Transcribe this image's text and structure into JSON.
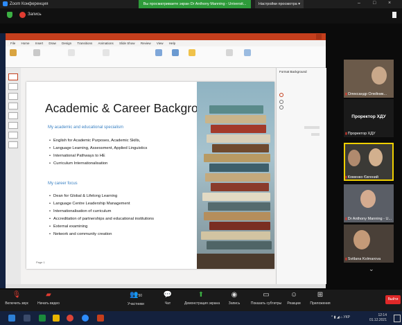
{
  "zoom": {
    "window_title": "Zoom Конференция",
    "share_banner": "Вы просматриваете экран Dr Anthony Manning - Universit...",
    "view_settings": "Настройки просмотра",
    "view_settings_arrow": "▾",
    "recording_label": "Запись"
  },
  "slide": {
    "title": "Academic & Career Background",
    "section1_heading": "My academic and educational specialism",
    "section1_items": [
      "English for Academic Purposes, Academic Skills,",
      "Language Learning, Assessment, Applied Linguistics",
      "International Pathways to HE",
      "Curriculum Internationalisation"
    ],
    "section2_heading": "My career focus",
    "section2_items": [
      "Dean for Global & Lifelong Learning",
      "Language Centre Leadership Management",
      "Internationalisation of curriculum",
      "Accreditation of partnerships and educational institutions",
      "External examining",
      "Network and community creation"
    ],
    "slide_number": "Page 1"
  },
  "ppt": {
    "tabs": [
      "File",
      "Home",
      "Insert",
      "Draw",
      "Design",
      "Transitions",
      "Animations",
      "Slide Show",
      "Review",
      "View",
      "Help"
    ],
    "pane_title": "Format Background"
  },
  "participants": [
    {
      "name": "Олександр Олейник..."
    },
    {
      "name": "Проректор ХДУ",
      "big": "Проректор ХДУ"
    },
    {
      "name": "Коменко Євгений"
    },
    {
      "name": "Dr Anthony Manning - U..."
    },
    {
      "name": "Svitlana Kolmarova"
    }
  ],
  "toolbar": {
    "mute": "Включить звук",
    "video": "Начать видео",
    "participants": "Участники",
    "participants_count": "50",
    "chat": "Чат",
    "share": "Демонстрация экрана",
    "record": "Запись",
    "captions": "Показать субтитры",
    "reactions": "Реакции",
    "apps": "Приложения",
    "leave": "Выйти"
  },
  "taskbar": {
    "lang": "УКР",
    "time": "12:14",
    "date": "01.12.2021"
  },
  "colors": {
    "ppt_accent": "#c43e1c",
    "zoom_green": "#2e9b3a",
    "leave_red": "#e02828",
    "slide_heading_blue": "#3b82c4"
  }
}
